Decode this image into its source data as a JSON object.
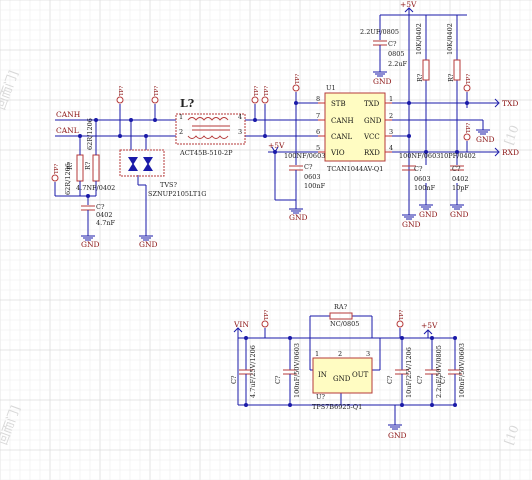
{
  "nets": {
    "canh": "CANH",
    "canl": "CANL",
    "txd": "TXD",
    "rxd": "RXD",
    "p5v": "+5V",
    "vin": "VIN",
    "gnd": "GND"
  },
  "tp_label": "TP?",
  "choke": {
    "ref": "L?",
    "part": "ACT45B-510-2P"
  },
  "tvs": {
    "ref": "TVS?",
    "part": "SZNUP2105LT1G"
  },
  "u1": {
    "ref": "U1",
    "part": "TCAN1044AV-Q1",
    "pins": [
      {
        "num": "8",
        "name": "STB"
      },
      {
        "num": "7",
        "name": "CANH"
      },
      {
        "num": "6",
        "name": "CANL"
      },
      {
        "num": "5",
        "name": "VIO"
      },
      {
        "num": "1",
        "name": "TXD"
      },
      {
        "num": "2",
        "name": "GND"
      },
      {
        "num": "3",
        "name": "VCC"
      },
      {
        "num": "4",
        "name": "RXD"
      }
    ]
  },
  "u7": {
    "ref": "U?",
    "part": "TPS7B6925-Q1",
    "pins": [
      {
        "num": "1",
        "name": "IN"
      },
      {
        "num": "2",
        "name": "GND"
      },
      {
        "num": "3",
        "name": "OUT"
      }
    ]
  },
  "ra7": {
    "ref": "RA?",
    "value": "NC/0805"
  },
  "top_cap": {
    "ref": "C?",
    "pkg": "0805",
    "value": "2.2uF",
    "label": "2.2UF/0805"
  },
  "can_resistors": [
    {
      "ref": "R?",
      "value": "62R/1206"
    },
    {
      "ref": "R?",
      "value": "62R/1206"
    }
  ],
  "split_cap": {
    "ref": "C?",
    "pkg": "0402",
    "value": "4.7nF",
    "label": "4.7NF/0402"
  },
  "vio_cap": {
    "ref": "C?",
    "pkg": "0603",
    "value": "100nF",
    "label": "100NF/0603"
  },
  "vcc_cap": {
    "ref": "C?",
    "pkg": "0603",
    "value": "100nF",
    "label": "100NF/0603"
  },
  "rxd_cap": {
    "ref": "C?",
    "pkg": "0402",
    "value": "10pF",
    "label": "10PF/0402"
  },
  "pullups": [
    {
      "ref": "R?",
      "value": "10K/0402"
    },
    {
      "ref": "R?",
      "value": "10K/0402"
    }
  ],
  "bottom_caps": [
    {
      "ref": "C?",
      "value": "4.7uF/25V/1206"
    },
    {
      "ref": "C?",
      "value": "100nF/50V/0603"
    },
    {
      "ref": "C?",
      "value": "10uF/25V/1206"
    },
    {
      "ref": "C?",
      "value": "2.2uF/50V/0805"
    },
    {
      "ref": "C?",
      "value": "100nF/50V/0603"
    }
  ],
  "watermark": [
    "[10",
    "回而门]"
  ]
}
